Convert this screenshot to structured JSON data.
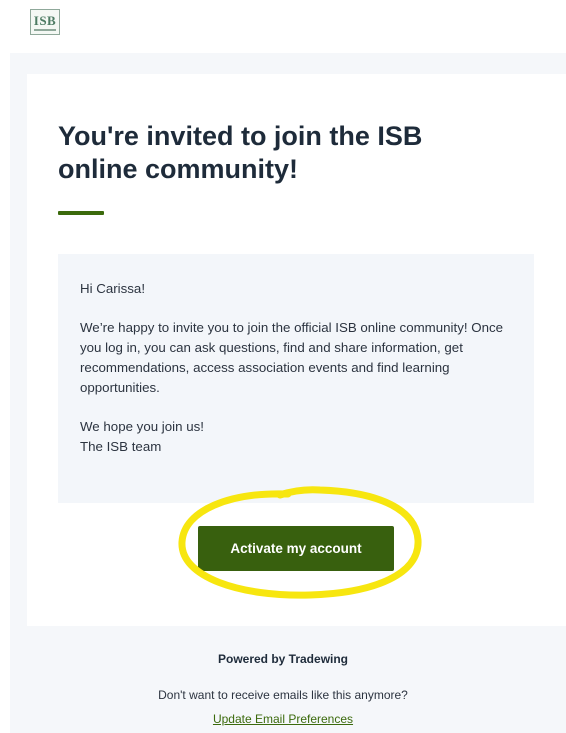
{
  "logo": {
    "text": "ISB"
  },
  "email": {
    "headline": "You're invited to join the ISB online community!",
    "greeting": "Hi Carissa!",
    "body": "We’re happy to invite you to join the official ISB online community! Once you log in, you can ask questions, find and share information, get recommendations, access association events and find learning opportunities.",
    "closing_line1": "We hope you join us!",
    "closing_line2": "The ISB team",
    "cta_label": "Activate my account"
  },
  "footer": {
    "powered_by": "Powered by Tradewing",
    "unsubscribe_prompt": "Don't want to receive emails like this anymore?",
    "preferences_link": "Update Email Preferences"
  },
  "colors": {
    "brand_green": "#38600e",
    "highlight_yellow": "#f7e60f",
    "heading_text": "#1e2b3a"
  }
}
